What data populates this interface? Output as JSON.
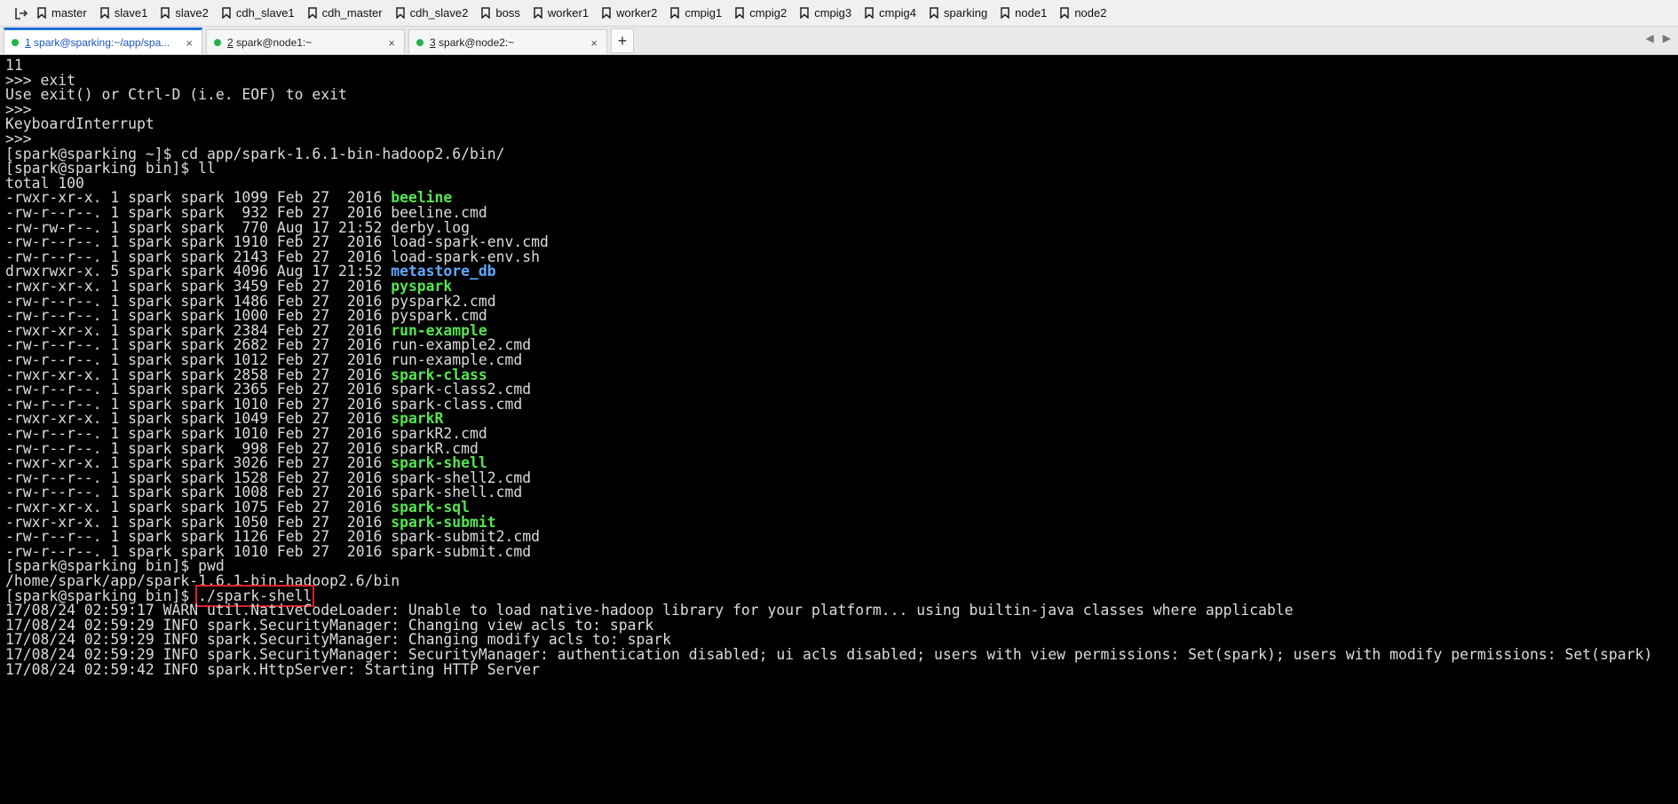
{
  "bookmarks": [
    "master",
    "slave1",
    "slave2",
    "cdh_slave1",
    "cdh_master",
    "cdh_slave2",
    "boss",
    "worker1",
    "worker2",
    "cmpig1",
    "cmpig2",
    "cmpig3",
    "cmpig4",
    "sparking",
    "node1",
    "node2"
  ],
  "tabs": [
    {
      "num": "1",
      "title": " spark@sparking:~/app/spa...",
      "active": true
    },
    {
      "num": "2",
      "title": " spark@node1:~",
      "active": false
    },
    {
      "num": "3",
      "title": " spark@node2:~",
      "active": false
    }
  ],
  "tab_close": "×",
  "new_tab": "+",
  "tab_nav": {
    "left": "◀",
    "right": "▶"
  },
  "colors": {
    "exec": "#55e64f",
    "dir": "#5ea9ff",
    "highlight": "#e02020",
    "tab_active": "#1a6fd8"
  },
  "terminal": {
    "pre_lines": [
      "11",
      ">>> exit",
      "Use exit() or Ctrl-D (i.e. EOF) to exit",
      ">>>",
      "KeyboardInterrupt",
      ">>>",
      "[spark@sparking ~]$ cd app/spark-1.6.1-bin-hadoop2.6/bin/",
      "[spark@sparking bin]$ ll",
      "total 100"
    ],
    "listing": [
      {
        "info": "-rwxr-xr-x. 1 spark spark 1099 Feb 27  2016 ",
        "name": "beeline",
        "type": "exec"
      },
      {
        "info": "-rw-r--r--. 1 spark spark  932 Feb 27  2016 ",
        "name": "beeline.cmd",
        "type": "file"
      },
      {
        "info": "-rw-rw-r--. 1 spark spark  770 Aug 17 21:52 ",
        "name": "derby.log",
        "type": "file"
      },
      {
        "info": "-rw-r--r--. 1 spark spark 1910 Feb 27  2016 ",
        "name": "load-spark-env.cmd",
        "type": "file"
      },
      {
        "info": "-rw-r--r--. 1 spark spark 2143 Feb 27  2016 ",
        "name": "load-spark-env.sh",
        "type": "file"
      },
      {
        "info": "drwxrwxr-x. 5 spark spark 4096 Aug 17 21:52 ",
        "name": "metastore_db",
        "type": "dir"
      },
      {
        "info": "-rwxr-xr-x. 1 spark spark 3459 Feb 27  2016 ",
        "name": "pyspark",
        "type": "exec"
      },
      {
        "info": "-rw-r--r--. 1 spark spark 1486 Feb 27  2016 ",
        "name": "pyspark2.cmd",
        "type": "file"
      },
      {
        "info": "-rw-r--r--. 1 spark spark 1000 Feb 27  2016 ",
        "name": "pyspark.cmd",
        "type": "file"
      },
      {
        "info": "-rwxr-xr-x. 1 spark spark 2384 Feb 27  2016 ",
        "name": "run-example",
        "type": "exec"
      },
      {
        "info": "-rw-r--r--. 1 spark spark 2682 Feb 27  2016 ",
        "name": "run-example2.cmd",
        "type": "file"
      },
      {
        "info": "-rw-r--r--. 1 spark spark 1012 Feb 27  2016 ",
        "name": "run-example.cmd",
        "type": "file"
      },
      {
        "info": "-rwxr-xr-x. 1 spark spark 2858 Feb 27  2016 ",
        "name": "spark-class",
        "type": "exec"
      },
      {
        "info": "-rw-r--r--. 1 spark spark 2365 Feb 27  2016 ",
        "name": "spark-class2.cmd",
        "type": "file"
      },
      {
        "info": "-rw-r--r--. 1 spark spark 1010 Feb 27  2016 ",
        "name": "spark-class.cmd",
        "type": "file"
      },
      {
        "info": "-rwxr-xr-x. 1 spark spark 1049 Feb 27  2016 ",
        "name": "sparkR",
        "type": "exec"
      },
      {
        "info": "-rw-r--r--. 1 spark spark 1010 Feb 27  2016 ",
        "name": "sparkR2.cmd",
        "type": "file"
      },
      {
        "info": "-rw-r--r--. 1 spark spark  998 Feb 27  2016 ",
        "name": "sparkR.cmd",
        "type": "file"
      },
      {
        "info": "-rwxr-xr-x. 1 spark spark 3026 Feb 27  2016 ",
        "name": "spark-shell",
        "type": "exec"
      },
      {
        "info": "-rw-r--r--. 1 spark spark 1528 Feb 27  2016 ",
        "name": "spark-shell2.cmd",
        "type": "file"
      },
      {
        "info": "-rw-r--r--. 1 spark spark 1008 Feb 27  2016 ",
        "name": "spark-shell.cmd",
        "type": "file"
      },
      {
        "info": "-rwxr-xr-x. 1 spark spark 1075 Feb 27  2016 ",
        "name": "spark-sql",
        "type": "exec"
      },
      {
        "info": "-rwxr-xr-x. 1 spark spark 1050 Feb 27  2016 ",
        "name": "spark-submit",
        "type": "exec"
      },
      {
        "info": "-rw-r--r--. 1 spark spark 1126 Feb 27  2016 ",
        "name": "spark-submit2.cmd",
        "type": "file"
      },
      {
        "info": "-rw-r--r--. 1 spark spark 1010 Feb 27  2016 ",
        "name": "spark-submit.cmd",
        "type": "file"
      }
    ],
    "post_lines": [
      "[spark@sparking bin]$ pwd",
      "/home/spark/app/spark-1.6.1-bin-hadoop2.6/bin"
    ],
    "prompt": "[spark@sparking bin]$ ",
    "command": "./spark-shell",
    "log_lines": [
      "17/08/24 02:59:17 WARN util.NativeCodeLoader: Unable to load native-hadoop library for your platform... using builtin-java classes where applicable",
      "17/08/24 02:59:29 INFO spark.SecurityManager: Changing view acls to: spark",
      "17/08/24 02:59:29 INFO spark.SecurityManager: Changing modify acls to: spark",
      "17/08/24 02:59:29 INFO spark.SecurityManager: SecurityManager: authentication disabled; ui acls disabled; users with view permissions: Set(spark); users with modify permissions: Set(spark)",
      "17/08/24 02:59:42 INFO spark.HttpServer: Starting HTTP Server"
    ]
  }
}
